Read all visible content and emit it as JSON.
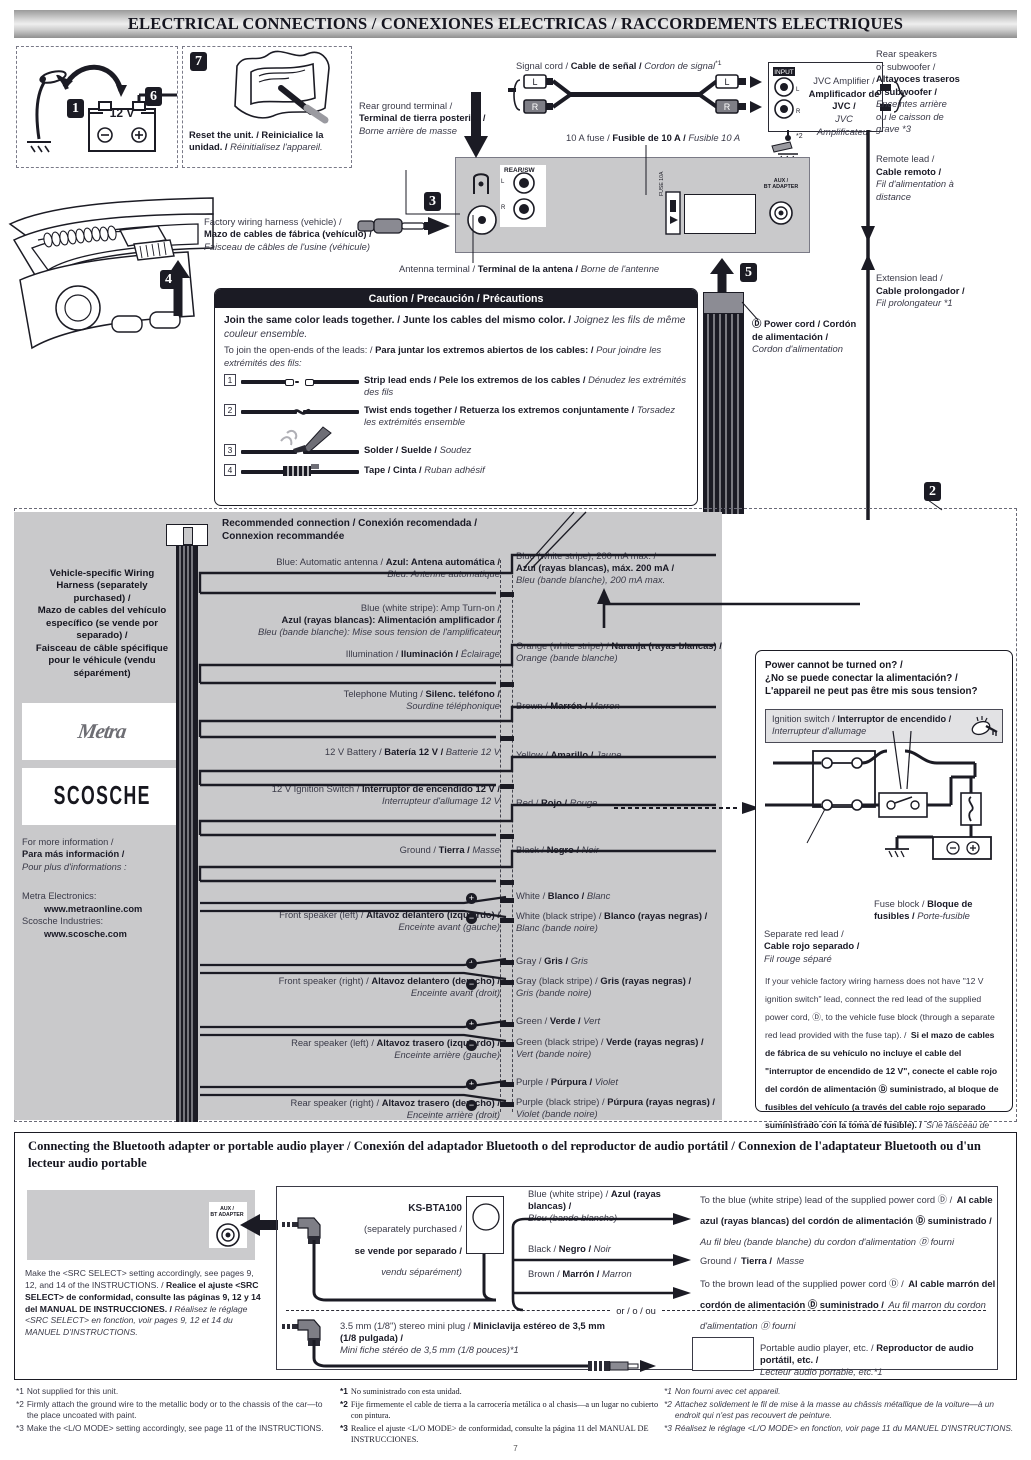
{
  "header": {
    "title": "ELECTRICAL CONNECTIONS / CONEXIONES ELECTRICAS / RACCORDEMENTS ELECTRIQUES"
  },
  "steps": {
    "battery_step_1": "1",
    "battery_step_6": "6",
    "reset_step_7": "7",
    "harness_step_4": "4",
    "antenna_step_3": "3",
    "powercord_step_5": "5",
    "region_step_2": "2",
    "battery_voltage": "12 V",
    "battery_minus": "⊖",
    "battery_plus": "⊕"
  },
  "top": {
    "reset_caption": "Reset the unit. / Reinicialice la unidad. / Réinitialisez l'appareil.",
    "reset_caption_en": "Reset the unit. /",
    "reset_caption_es": "Reinicialice la",
    "reset_caption_es2": "unidad. /",
    "reset_caption_fr": "Réinitialisez l'appareil.",
    "rear_ground_en": "Rear ground terminal /",
    "rear_ground_es": "Terminal de tierra posterior /",
    "rear_ground_fr": "Borne arrière de masse",
    "factory_harness_en": "Factory wiring harness (vehicle) /",
    "factory_harness_es": "Mazo de cables de fábrica (vehículo) /",
    "factory_harness_fr": "Faisceau de câbles de l'usine (véhicule)",
    "antenna_terminal": "Antenna terminal / Terminal de la antena / Borne de l'antenne",
    "antenna_terminal_en": "Antenna terminal /",
    "antenna_terminal_es": "Terminal de la antena /",
    "antenna_terminal_fr": "Borne de l'antenne",
    "signal_cord": "Signal cord / Cable de señal / Cordon de signal",
    "signal_cord_en": "Signal cord /",
    "signal_cord_es": "Cable de señal /",
    "signal_cord_fr": "Cordon de signal",
    "signal_cord_note": "*1",
    "fuse_10a_en": "10 A fuse /",
    "fuse_10a_es": "Fusible de 10 A /",
    "fuse_10a_fr": "Fusible 10 A",
    "amp_en": "JVC Amplifier /",
    "amp_es": "Amplificador de JVC /",
    "amp_fr": "JVC Amplificateur",
    "rear_spk_en1": "Rear speakers",
    "rear_spk_en2": "or subwoofer /",
    "rear_spk_es1": "Altavoces traseros",
    "rear_spk_es2": "o subwoofer /",
    "rear_spk_fr1": "Enceintes arrière",
    "rear_spk_fr2": "ou le caisson de",
    "rear_spk_fr3": "grave *3",
    "remote_lead_en": "Remote lead /",
    "remote_lead_es": "Cable remoto /",
    "remote_lead_fr1": "Fil d'alimentation à",
    "remote_lead_fr2": "distance",
    "ext_lead_en": "Extension lead /",
    "ext_lead_es": "Cable prolongador /",
    "ext_lead_fr": "Fil prolongateur *1",
    "power_cord_en": "Ⓓ Power cord / Cordón",
    "power_cord_es": "de alimentación /",
    "power_cord_fr": "Cordon d'alimentation",
    "jack_rear_sw": "REAR/SW",
    "jack_l": "L",
    "jack_r": "R",
    "jack_input": "INPUT",
    "jack_fuse": "FUSE 10A",
    "jack_aux": "AUX /\nBT ADAPTER",
    "ground_note": "*2"
  },
  "caution": {
    "title": "Caution / Precaución / Précautions",
    "line1_en": "Join the same color leads together. /",
    "line1_es": "Junte los cables del mismo color. /",
    "line1_fr": "Joignez les fils de même couleur ensemble.",
    "line2_en": "To join the open-ends of the leads: /",
    "line2_es": "Para juntar los extremos abiertos de los cables: /",
    "line2_fr": "Pour joindre les extrémités des fils:",
    "steps": [
      {
        "num": "1",
        "en": "Strip lead ends /",
        "es": "Pele los extremos de los cables /",
        "fr": "Dénudez les extrémités des fils"
      },
      {
        "num": "2",
        "en": "Twist ends together /",
        "es": "Retuerza los extremos conjuntamente /",
        "fr": "Torsadez les extrémités ensemble"
      },
      {
        "num": "3",
        "en": "Solder /",
        "es": "Suelde /",
        "fr": "Soudez"
      },
      {
        "num": "4",
        "en": "Tape /",
        "es": "Cinta /",
        "fr": "Ruban adhésif"
      }
    ]
  },
  "harness": {
    "recommended_head_1": "Recommended connection / Conexión recomendada /",
    "recommended_head_2": "Connexion recommandée",
    "vehicle_note_1": "Vehicle-specific Wiring",
    "vehicle_note_2": "Harness (separately",
    "vehicle_note_3": "purchased) /",
    "vehicle_note_4": "Mazo de cables del vehículo",
    "vehicle_note_5": "específico (se vende por",
    "vehicle_note_6": "separado) /",
    "vehicle_note_7": "Faisceau de câble spécifique",
    "vehicle_note_8": "pour le véhicule (vendu",
    "vehicle_note_9": "séparément)",
    "metra_logo": "Metra",
    "scosche_logo": "SCOSCHE",
    "more_info_en": "For more information /",
    "more_info_es": "Para más información /",
    "more_info_fr": "Pour plus d'informations :",
    "metra_label": "Metra Electronics:",
    "metra_url": "www.metraonline.com",
    "scosche_label": "Scosche Industries:",
    "scosche_url": "www.scosche.com",
    "rows": [
      {
        "left_en": "Blue: Automatic antenna /",
        "left_es": "Azul: Antena automática /",
        "left_fr": "Bleu: Antenne automatique",
        "right_en": "Blue (white stripe), 200 mA max. /",
        "right_es": "Azul (rayas blancas), máx. 200 mA /",
        "right_fr": "Bleu (bande blanche), 200 mA max.",
        "polarity": ""
      },
      {
        "left_en": "Blue (white stripe): Amp Turn-on /",
        "left_es": "Azul (rayas blancas): Alimentación amplificador /",
        "left_fr": "Bleu (bande blanche): Mise sous tension de l'amplificateur",
        "right_en": "",
        "right_es": "",
        "right_fr": "",
        "polarity": ""
      },
      {
        "left_en": "Illumination /",
        "left_es": "Iluminación /",
        "left_fr": "Éclairage",
        "right_en": "Orange (white stripe) /",
        "right_es": "Naranja (rayas blancas) /",
        "right_fr": "Orange (bande blanche)",
        "polarity": ""
      },
      {
        "left_en": "Telephone Muting /",
        "left_es": "Silenc. teléfono /",
        "left_fr": "Sourdine téléphonique",
        "right_en": "Brown /",
        "right_es": "Marrón /",
        "right_fr": "Marron",
        "polarity": ""
      },
      {
        "left_en": "12 V Battery /",
        "left_es": "Batería 12 V /",
        "left_fr": "Batterie 12 V",
        "right_en": "Yellow /",
        "right_es": "Amarillo /",
        "right_fr": "Jaune",
        "polarity": ""
      },
      {
        "left_en": "12 V Ignition Switch /",
        "left_es": "Interruptor de encendido 12 V /",
        "left_fr": "Interrupteur d'allumage 12 V",
        "right_en": "Red /",
        "right_es": "Rojo /",
        "right_fr": "Rouge",
        "polarity": ""
      },
      {
        "left_en": "Ground /",
        "left_es": "Tierra /",
        "left_fr": "Masse",
        "right_en": "Black /",
        "right_es": "Negro /",
        "right_fr": "Noir",
        "polarity": ""
      }
    ],
    "speakers": [
      {
        "left_en": "Front speaker (left) /",
        "left_es": "Altavoz delantero (izquierdo) /",
        "left_fr": "Enceinte avant (gauche)",
        "plus_en": "White /",
        "plus_es": "Blanco /",
        "plus_fr": "Blanc",
        "minus_en": "White (black stripe) /",
        "minus_es": "Blanco (rayas negras) /",
        "minus_fr": "Blanc (bande noire)"
      },
      {
        "left_en": "Front speaker (right) /",
        "left_es": "Altavoz delantero (derecho) /",
        "left_fr": "Enceinte avant (droit)",
        "plus_en": "Gray /",
        "plus_es": "Gris /",
        "plus_fr": "Gris",
        "minus_en": "Gray (black stripe) /",
        "minus_es": "Gris (rayas negras) /",
        "minus_fr": "Gris (bande noire)"
      },
      {
        "left_en": "Rear speaker (left) /",
        "left_es": "Altavoz trasero (izquierdo) /",
        "left_fr": "Enceinte arrière (gauche)",
        "plus_en": "Green /",
        "plus_es": "Verde /",
        "plus_fr": "Vert",
        "minus_en": "Green (black stripe) /",
        "minus_es": "Verde (rayas negras) /",
        "minus_fr": "Vert (bande noire)"
      },
      {
        "left_en": "Rear speaker (right) /",
        "left_es": "Altavoz trasero (derecho) /",
        "left_fr": "Enceinte arrière (droit)",
        "plus_en": "Purple /",
        "plus_es": "Púrpura /",
        "plus_fr": "Violet",
        "minus_en": "Purple (black stripe) /",
        "minus_es": "Púrpura (rayas negras) /",
        "minus_fr": "Violet (bande noire)"
      }
    ],
    "plus_sign": "+",
    "minus_sign": "−"
  },
  "power_box": {
    "title_en": "Power cannot be turned on? /",
    "title_es": "¿No se puede conectar la alimentación? /",
    "title_fr": "L'appareil ne peut pas être mis sous tension?",
    "ignition_en": "Ignition switch /",
    "ignition_es": "Interruptor de encendido /",
    "ignition_fr": "Interrupteur d'allumage",
    "fuse_block_en": "Fuse block /",
    "fuse_block_es": "Bloque de fusibles /",
    "fuse_block_fr": "Porte-fusible",
    "sep_red_en": "Separate red lead /",
    "sep_red_es": "Cable rojo separado /",
    "sep_red_fr": "Fil rouge séparé",
    "note_en": "If your vehicle factory wiring harness does not have \"12 V ignition switch\" lead, connect the red lead of the supplied power cord, Ⓓ, to the vehicle fuse block (through a separate red lead provided with the fuse tap). /",
    "note_es": "Si el mazo de cables de fábrica de su vehículo no incluye el cable del \"interruptor de encendido de 12 V\", conecte el cable rojo del cordón de alimentación Ⓓ suministrado, al bloque de fusibles del vehículo (a través del cable rojo separado suministrado con la toma de fusible). /",
    "note_fr": "Si le faisceau de câbles de votre véhicule ne possède pas de fil \"Interrupteur d'allumage 12 V\", connectez le fil rouge du cordon d'alimentation fourni, Ⓓ, au porte-fusible du véhicule (un fil rouge séparé est fourni avec le porte-fusible)."
  },
  "bluetooth": {
    "title": "Connecting the Bluetooth adapter or portable audio player / Conexión del adaptador Bluetooth o del reproductor de audio portátil / Connexion de l'adaptateur Bluetooth ou d'un lecteur audio portable",
    "src_note_en": "Make the <SRC SELECT> setting accordingly, see pages 9, 12, and 14 of the INSTRUCTIONS. /",
    "src_note_es": "Realice el ajuste <SRC SELECT> de conformidad, consulte las páginas 9, 12 y 14 del MANUAL DE INSTRUCCIONES. /",
    "src_note_fr": "Réalisez le réglage <SRC SELECT> en fonction, voir pages 9, 12 et 14 du MANUEL D'INSTRUCTIONS.",
    "aux_jack_label": "AUX /\nBT ADAPTER",
    "ks_model": "KS-BTA100",
    "ks_note_en": "(separately purchased /",
    "ks_note_es": "se vende por separado /",
    "ks_note_fr": "vendu séparément)",
    "lead_blue_en": "Blue (white stripe) /",
    "lead_blue_es": "Azul (rayas blancas) /",
    "lead_blue_fr": "Bleu (bande blanche)",
    "lead_black_en": "Black /",
    "lead_black_es": "Negro /",
    "lead_black_fr": "Noir",
    "lead_brown_en": "Brown /",
    "lead_brown_es": "Marrón /",
    "lead_brown_fr": "Marron",
    "dest_blue_en": "To the blue (white stripe) lead of the supplied power cord Ⓓ /",
    "dest_blue_es": "Al cable azul (rayas blancas) del cordón de alimentación Ⓓ suministrado /",
    "dest_blue_fr": "Au fil bleu (bande blanche) du cordon d'alimentation Ⓓ fourni",
    "dest_black_en": "Ground /",
    "dest_black_es": "Tierra /",
    "dest_black_fr": "Masse",
    "dest_brown_en": "To the brown lead of the supplied power cord Ⓓ /",
    "dest_brown_es": "Al cable marrón del cordón de alimentación Ⓓ suministrado /",
    "dest_brown_fr": "Au fil marron du cordon d'alimentation Ⓓ fourni",
    "or_divider": "or / o / ou",
    "miniplug_en": "3.5 mm (1/8\") stereo mini plug /",
    "miniplug_es": "Miniclavija estéreo de 3,5 mm (1/8 pulgada) /",
    "miniplug_fr": "Mini fiche stéréo de 3,5 mm (1/8 pouces)*1",
    "portable_en": "Portable audio player, etc. /",
    "portable_es": "Reproductor de audio portátil, etc. /",
    "portable_fr": "Lecteur audio portable, etc.*1"
  },
  "footnotes": {
    "en": [
      {
        "mark": "*1",
        "text": "Not supplied for this unit."
      },
      {
        "mark": "*2",
        "text": "Firmly attach the ground wire to the metallic body or to the chassis of the car—to the place uncoated with paint."
      },
      {
        "mark": "*3",
        "text": "Make the <L/O MODE> setting accordingly, see page 11 of the INSTRUCTIONS."
      }
    ],
    "es": [
      {
        "mark": "*1",
        "text": "No suministrado con esta unidad."
      },
      {
        "mark": "*2",
        "text": "Fije firmemente el cable de tierra a la carrocería metálica o al chasis—a un lugar no cubierto con pintura."
      },
      {
        "mark": "*3",
        "text": "Realice el ajuste <L/O MODE> de conformidad, consulte la página 11 del MANUAL DE INSTRUCCIONES."
      }
    ],
    "fr": [
      {
        "mark": "*1",
        "text": "Non fourni avec cet appareil."
      },
      {
        "mark": "*2",
        "text": "Attachez solidement le fil de mise à la masse au châssis métallique de la voiture—à un endroit qui n'est pas recouvert de peinture."
      },
      {
        "mark": "*3",
        "text": "Réalisez le réglage <L/O MODE> en fonction, voir page 11 du MANUEL D'INSTRUCTIONS."
      }
    ]
  },
  "page_number": "7"
}
